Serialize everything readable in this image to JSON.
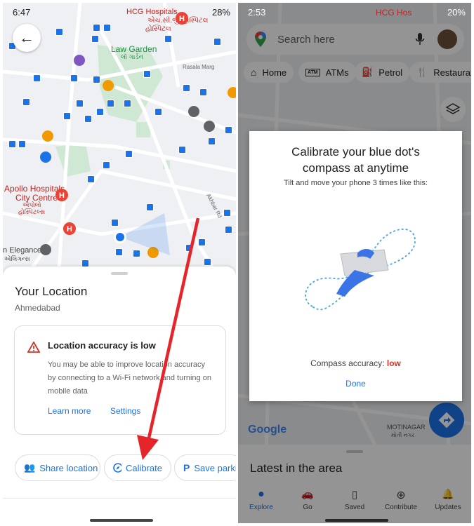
{
  "left_screen": {
    "status_bar": {
      "time": "6:47",
      "battery": "28%"
    },
    "map_labels": {
      "hospital_top": "HCG Hospitals",
      "hospital_top_local": "એચ.સી.જી હોસ્પિટલ",
      "law_garden": "Law Garden",
      "law_garden_local": "લૉ ગાર્ડન",
      "rasala_marg": "Rasala Marg",
      "apollo_1": "Apollo Hospitals",
      "apollo_2": "City Centre",
      "apollo_local_1": "એપોલો",
      "apollo_local_2": "હોસ્પિટલ્સ",
      "akhbar_rd": "Akhbar Rd",
      "elegance": "n Elegance",
      "elegance_local": "એલિગન્સ"
    },
    "sheet": {
      "title": "Your Location",
      "subtitle": "Ahmedabad",
      "warning_title": "Location accuracy is low",
      "warning_body_1": "You may be able to improve location accuracy",
      "warning_body_2": "by connecting to a Wi-Fi network and turning on",
      "warning_body_3": "mobile data",
      "learn_more": "Learn more",
      "settings": "Settings",
      "chips": [
        "Share location",
        "Calibrate",
        "Save parki"
      ]
    },
    "colors": {
      "arrow": "#e5252a",
      "blue_dot": "#1a73e8"
    }
  },
  "right_screen": {
    "status_bar": {
      "time": "2:53",
      "battery": "20%"
    },
    "search": {
      "placeholder": "Search here"
    },
    "category_pills": [
      "Home",
      "ATMs",
      "Petrol",
      "Restaurant"
    ],
    "atm_badge": "ATM",
    "map_labels": {
      "hospital_top": "HCG Hos",
      "motinagar": "MOTINAGAR",
      "motinagar_local": "મોતી નગર",
      "google": "Google"
    },
    "dialog": {
      "title_1": "Calibrate your blue dot's",
      "title_2": "compass at anytime",
      "instruction": "Tilt and move your phone 3 times like this:",
      "accuracy_label": "Compass accuracy:",
      "accuracy_value": "low",
      "done": "Done"
    },
    "latest_title": "Latest in the area",
    "nav": [
      "Explore",
      "Go",
      "Saved",
      "Contribute",
      "Updates"
    ]
  }
}
